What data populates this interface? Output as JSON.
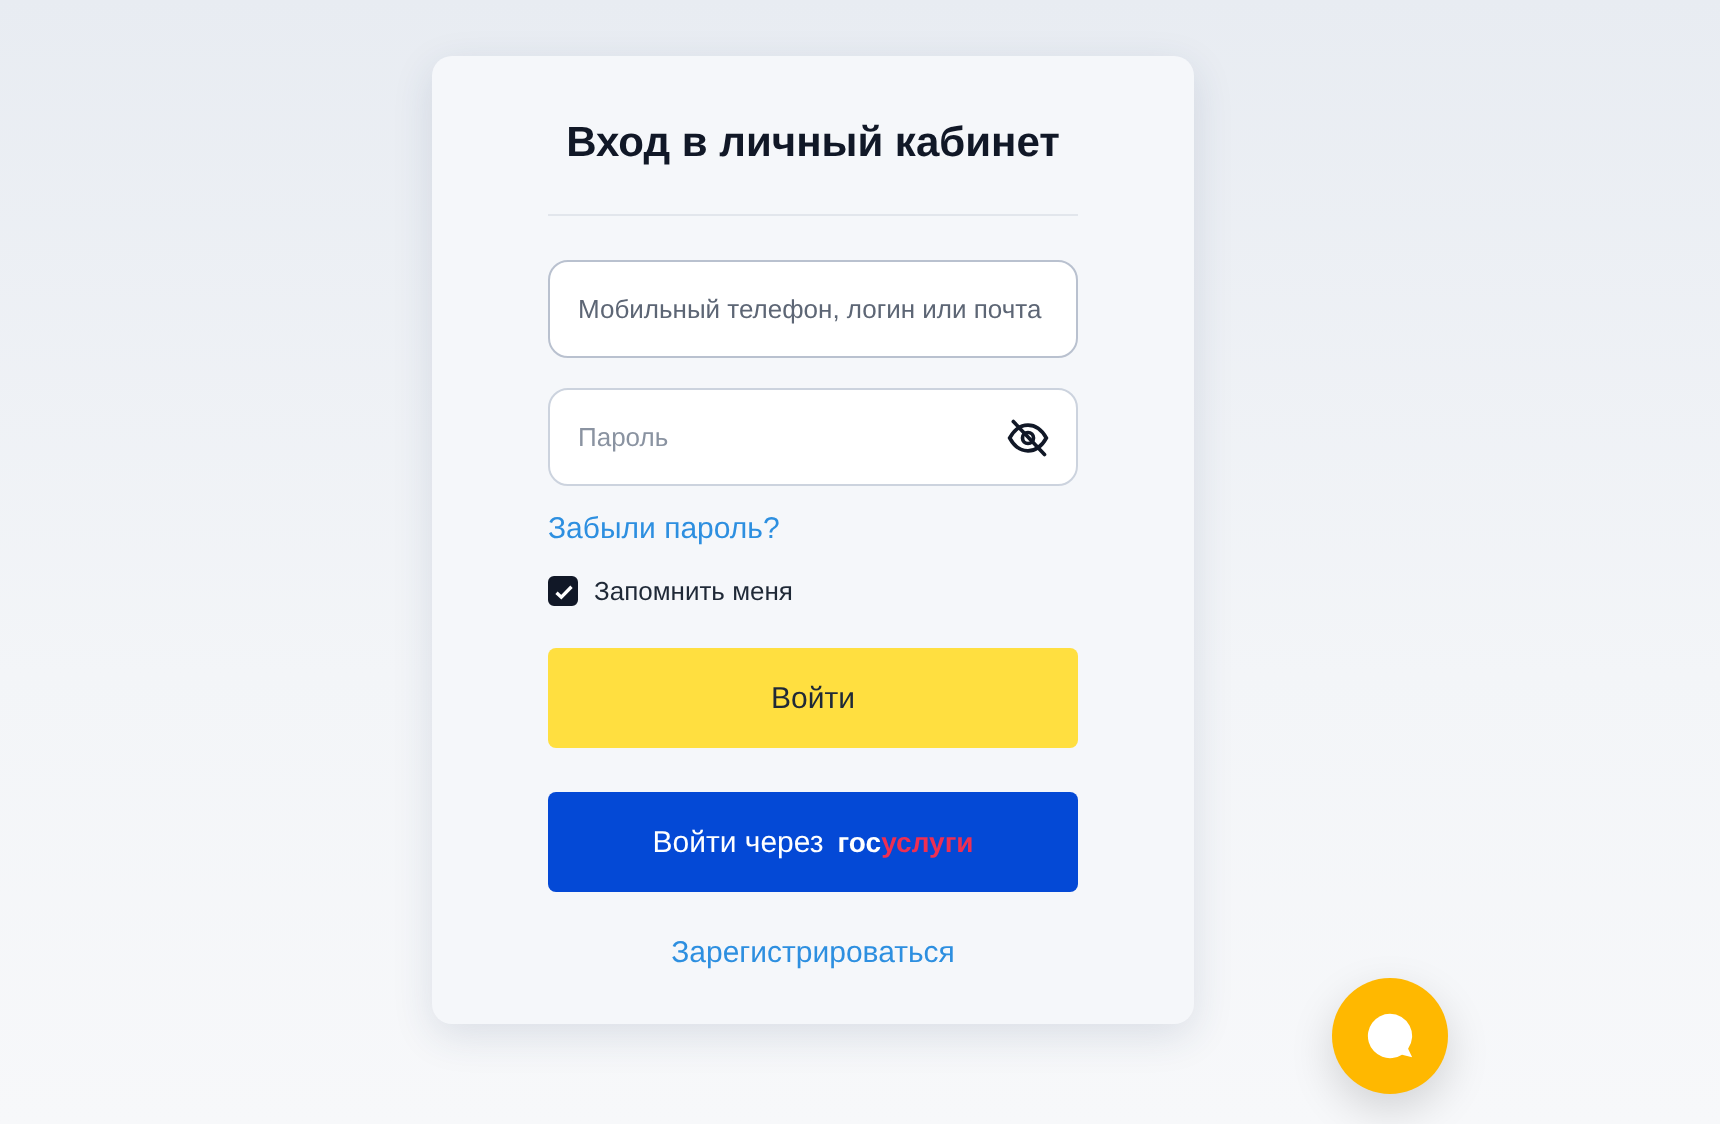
{
  "title": "Вход в личный кабинет",
  "login_field": {
    "placeholder": "Мобильный телефон, логин или почта"
  },
  "password_field": {
    "placeholder": "Пароль",
    "visible": false
  },
  "forgot_link": "Забыли пароль?",
  "remember": {
    "label": "Запомнить меня",
    "checked": true
  },
  "login_button": "Войти",
  "gosuslugi_button": {
    "label": "Войти через",
    "logo_white": "гос",
    "logo_red": "услуги"
  },
  "register_link": "Зарегистрироваться"
}
